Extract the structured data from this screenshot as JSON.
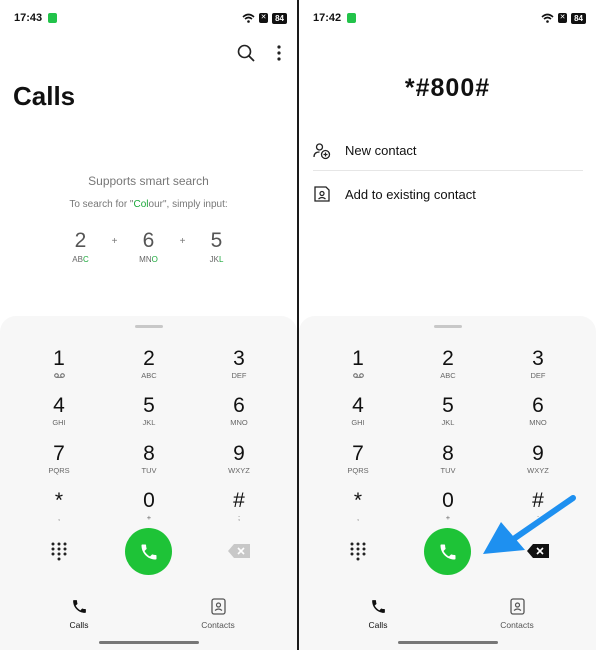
{
  "left_screen": {
    "status": {
      "time": "17:43",
      "battery": "84"
    },
    "title": "Calls",
    "smart_search": {
      "heading": "Supports smart search",
      "hint_before": "To search for \"",
      "hint_c": "C",
      "hint_o": "o",
      "hint_l": "l",
      "hint_rest": "our\", simply input:",
      "example": [
        {
          "digit": "2",
          "letters_pre": "AB",
          "letters_hl": "C",
          "letters_post": ""
        },
        {
          "digit": "6",
          "letters_pre": "MN",
          "letters_hl": "O",
          "letters_post": ""
        },
        {
          "digit": "5",
          "letters_pre": "JK",
          "letters_hl": "L",
          "letters_post": ""
        }
      ],
      "plus": "+"
    }
  },
  "right_screen": {
    "status": {
      "time": "17:42",
      "battery": "84"
    },
    "dialed_number": "*#800#",
    "menu": [
      {
        "label": "New contact",
        "icon": "add-contact-icon"
      },
      {
        "label": "Add to existing contact",
        "icon": "save-contact-icon"
      }
    ]
  },
  "dialpad": {
    "keys": [
      {
        "digit": "1",
        "letters": ""
      },
      {
        "digit": "2",
        "letters": "ABC"
      },
      {
        "digit": "3",
        "letters": "DEF"
      },
      {
        "digit": "4",
        "letters": "GHI"
      },
      {
        "digit": "5",
        "letters": "JKL"
      },
      {
        "digit": "6",
        "letters": "MNO"
      },
      {
        "digit": "7",
        "letters": "PQRS"
      },
      {
        "digit": "8",
        "letters": "TUV"
      },
      {
        "digit": "9",
        "letters": "WXYZ"
      },
      {
        "digit": "*",
        "letters": ","
      },
      {
        "digit": "0",
        "letters": "+"
      },
      {
        "digit": "#",
        "letters": ";"
      }
    ]
  },
  "nav": {
    "calls_label": "Calls",
    "contacts_label": "Contacts"
  },
  "colors": {
    "call_green": "#1ec337",
    "accent_green": "#1aa83a",
    "arrow_blue": "#1e90f0"
  }
}
